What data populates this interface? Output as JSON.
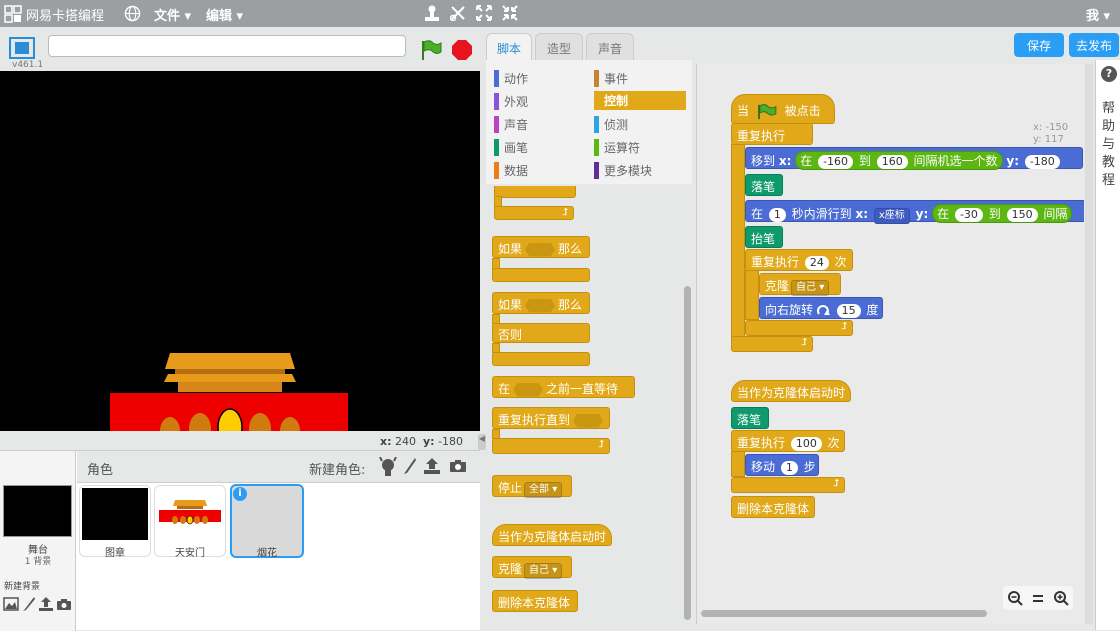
{
  "topbar": {
    "logo": "网易卡搭编程",
    "menu_file": "文件",
    "menu_edit": "编辑",
    "user_char": "我"
  },
  "stage": {
    "title_value": "",
    "version": "v461.1",
    "coords_x_label": "x:",
    "coords_x": "240",
    "coords_y_label": "y:",
    "coords_y": "-180"
  },
  "sprites": {
    "header": "角色",
    "new_sprite": "新建角色:",
    "stage_label": "舞台",
    "stage_count": "1 背景",
    "new_backdrop": "新建背景",
    "items": [
      {
        "name": "图章"
      },
      {
        "name": "天安门"
      },
      {
        "name": "烟花"
      }
    ]
  },
  "tabs": {
    "scripts": "脚本",
    "costumes": "造型",
    "sounds": "声音"
  },
  "buttons": {
    "save": "保存",
    "publish": "去发布"
  },
  "categories": [
    {
      "label": "动作",
      "color": "#4a6cd4"
    },
    {
      "label": "事件",
      "color": "#c88330"
    },
    {
      "label": "外观",
      "color": "#8a55d7"
    },
    {
      "label": "控制",
      "color": "#e1a91a"
    },
    {
      "label": "声音",
      "color": "#bb42c3"
    },
    {
      "label": "侦测",
      "color": "#2ca5e2"
    },
    {
      "label": "画笔",
      "color": "#0e9a6c"
    },
    {
      "label": "运算符",
      "color": "#5cb712"
    },
    {
      "label": "数据",
      "color": "#ee7d16"
    },
    {
      "label": "更多模块",
      "color": "#632d99"
    }
  ],
  "palette": {
    "if_then_1": "如果",
    "if_then_1b": "那么",
    "if_else_a": "如果",
    "if_else_b": "那么",
    "if_else_c": "否则",
    "wait_until_a": "在",
    "wait_until_b": "之前一直等待",
    "repeat_until": "重复执行直到",
    "stop": "停止",
    "stop_opt": "全部",
    "when_clone": "当作为克隆体启动时",
    "clone": "克隆",
    "clone_opt": "自己",
    "delete_clone": "删除本克隆体"
  },
  "script1": {
    "hat_a": "当",
    "hat_b": "被点击",
    "forever": "重复执行",
    "goto": "移到",
    "x": "x:",
    "in": "在",
    "rand_min": "-160",
    "to": "到",
    "rand_max": "160",
    "random": "间隔机选一个数",
    "y": "y:",
    "y_val": "-180",
    "pen_down": "落笔",
    "glide_a": "在",
    "glide_secs": "1",
    "glide_b": "秒内滑行到",
    "glide_x": "x:",
    "glide_xpos": "x座标",
    "glide_y": "y:",
    "glide_in": "在",
    "glide_min": "-30",
    "glide_to": "到",
    "glide_max": "150",
    "glide_rand": "间隔",
    "pen_up": "抬笔",
    "repeat": "重复执行",
    "repeat_n": "24",
    "repeat_unit": "次",
    "clone": "克隆",
    "clone_opt": "自己",
    "turn": "向右旋转",
    "turn_deg": "15",
    "turn_unit": "度"
  },
  "script2": {
    "hat": "当作为克隆体启动时",
    "pen_down": "落笔",
    "repeat": "重复执行",
    "repeat_n": "100",
    "repeat_unit": "次",
    "move": "移动",
    "move_n": "1",
    "move_unit": "步",
    "delete": "删除本克隆体"
  },
  "script_coords": {
    "x": "x: -150",
    "y": "y: 117"
  },
  "help": {
    "text": "帮助与教程"
  }
}
